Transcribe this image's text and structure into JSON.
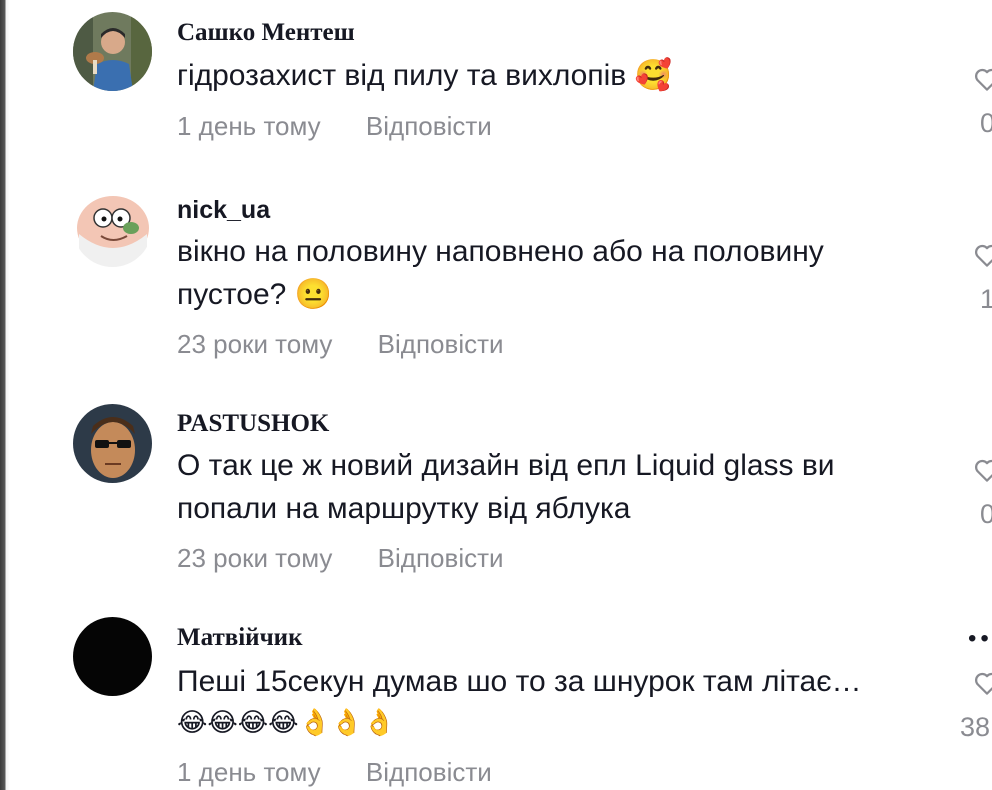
{
  "comments": [
    {
      "username": "Сашко Ментеш",
      "text": "гідрозахист від пилу та вихлопів 🥰",
      "time": "1 день тому",
      "reply": "Відповісти",
      "likes": "0"
    },
    {
      "username": "nick_ua",
      "text": "вікно на половину наповнено або на половину пустое? 😐",
      "time": "23 роки тому",
      "reply": "Відповісти",
      "likes": "1"
    },
    {
      "username": "PASTUSHOK",
      "text": "О так це ж новий дизайн від епл Liquid glass ви попали на маршрутку від яблука",
      "time": "23 роки тому",
      "reply": "Відповісти",
      "likes": "0"
    },
    {
      "username": "Матвійчик",
      "text": "Пеші 15секун думав шо то за шнурок там літає…",
      "text2": "😂😂😂😂👌👌👌",
      "time": "1 день тому",
      "reply": "Відповісти",
      "likes": "38"
    }
  ],
  "more_icon": "more-dots-icon",
  "like_icon": "heart-icon"
}
